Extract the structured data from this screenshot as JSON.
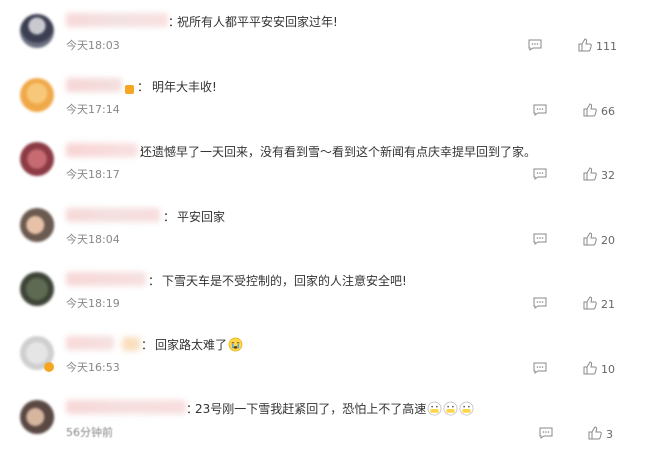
{
  "comments": [
    {
      "text": "祝所有人都平平安安回家过年!",
      "time": "今天18:03",
      "likes": "111"
    },
    {
      "text": "明年大丰收!",
      "time": "今天17:14",
      "likes": "66"
    },
    {
      "text": "还遗憾早了一天回来，没有看到雪～看到这个新闻有点庆幸提早回到了家。",
      "time": "今天18:17",
      "likes": "32"
    },
    {
      "text": "平安回家",
      "time": "今天18:04",
      "likes": "20"
    },
    {
      "text": "下雪天车是不受控制的，回家的人注意安全吧!",
      "time": "今天18:19",
      "likes": "21"
    },
    {
      "text": "回家路太难了",
      "time": "今天16:53",
      "likes": "10"
    },
    {
      "text": "23号刚一下雪我赶紧回了，恐怕上不了高速",
      "time": "56分钟前",
      "likes": "3"
    }
  ],
  "icons": {
    "reply": "comment-icon",
    "like": "thumbs-up-icon",
    "emoji_cry": "crying-face-emoji",
    "emoji_mask": "mask-face-emoji"
  },
  "colors": {
    "time": "#888888",
    "count": "#666666",
    "badge": "#f5a623"
  }
}
